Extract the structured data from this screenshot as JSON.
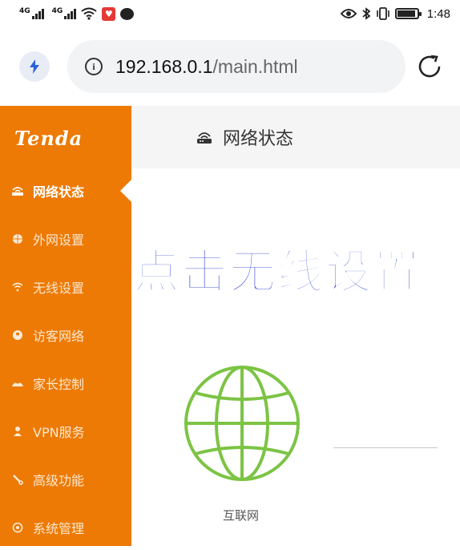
{
  "status_bar": {
    "signal1_tag": "4G",
    "signal2_tag": "4G",
    "time": "1:48"
  },
  "browser": {
    "url_host": "192.168.0.1",
    "url_path": "/main.html"
  },
  "sidebar": {
    "logo": "Tenda",
    "items": [
      {
        "label": "网络状态",
        "icon": "router-icon",
        "active": true
      },
      {
        "label": "外网设置",
        "icon": "globe-icon",
        "active": false
      },
      {
        "label": "无线设置",
        "icon": "wifi-icon",
        "active": false
      },
      {
        "label": "访客网络",
        "icon": "guest-icon",
        "active": false
      },
      {
        "label": "家长控制",
        "icon": "parental-control-icon",
        "active": false
      },
      {
        "label": "VPN服务",
        "icon": "vpn-icon",
        "active": false
      },
      {
        "label": "高级功能",
        "icon": "wrench-icon",
        "active": false
      },
      {
        "label": "系统管理",
        "icon": "gear-icon",
        "active": false
      }
    ]
  },
  "main": {
    "header_title": "网络状态",
    "overlay_text": "点击无线设置",
    "internet_label": "互联网"
  },
  "colors": {
    "sidebar_orange": "#ed7a04",
    "overlay_blue": "#3b4fd6",
    "globe_green": "#7cc444"
  }
}
